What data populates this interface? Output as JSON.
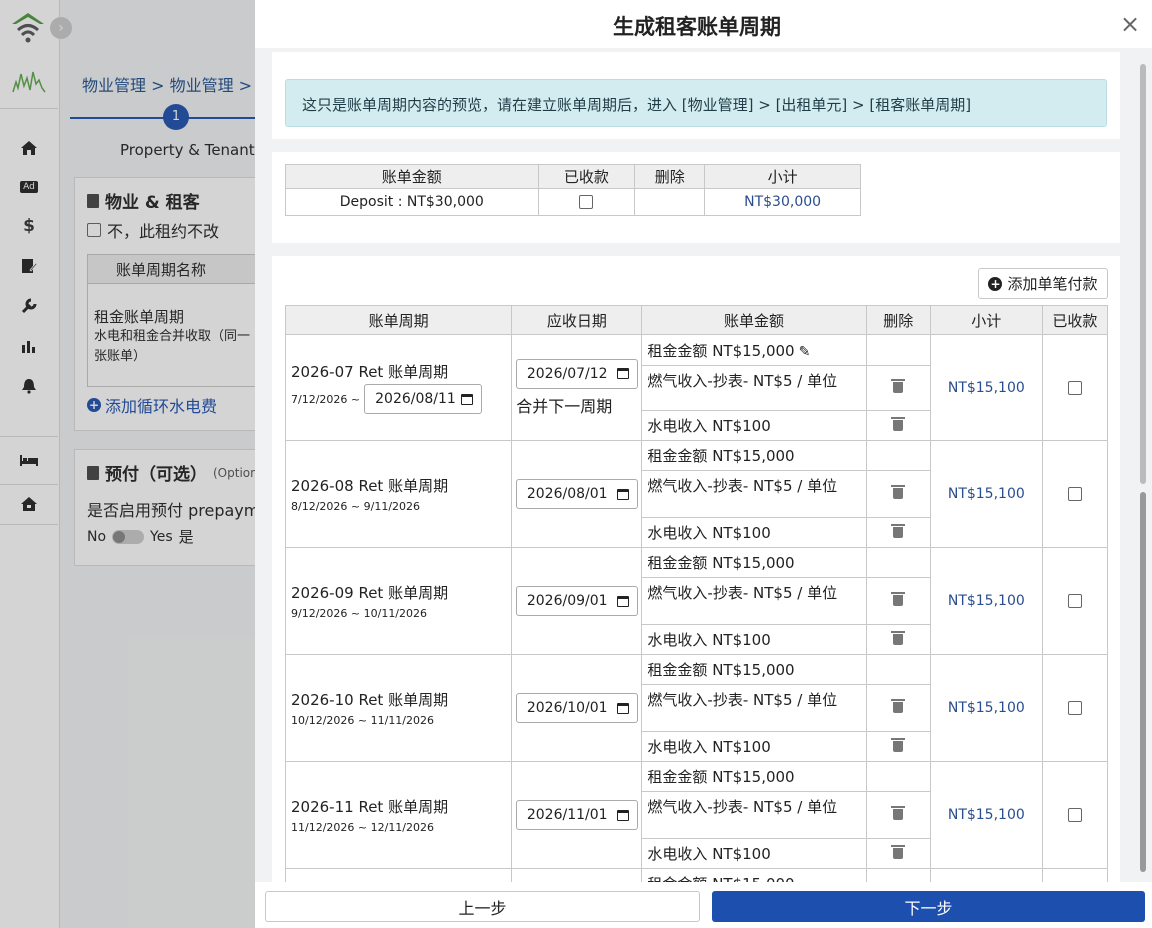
{
  "bg": {
    "breadcrumb": "物业管理 > 物业管理 > Ad",
    "step_number": "1",
    "step_label": "Property & Tenant",
    "section1_title": "物业 & 租客",
    "no_change_label": "不，此租约不改",
    "cycle_name_header": "账单周期名称",
    "cycle_name": "租金账单周期",
    "cycle_desc": "水电和租金合并收取（同一张账单）",
    "add_utility": "添加循环水电费",
    "section2_title": "预付（可选）",
    "section2_optional": "(Optional",
    "prepay_question": "是否启用预付 prepayme",
    "toggle_no": "No",
    "toggle_yes": "Yes",
    "toggle_yes_cn": "是"
  },
  "sidebar": {
    "icons": [
      "home-icon",
      "ad-icon",
      "dollar-icon",
      "edit-document-icon",
      "wrench-icon",
      "bar-chart-icon",
      "bell-icon",
      "bed-icon",
      "house-icon"
    ]
  },
  "modal": {
    "title": "生成租客账单周期",
    "close": "×",
    "notice": "这只是账单周期内容的预览，请在建立账单周期后，进入 [物业管理] > [出租单元] > [租客账单周期]",
    "deposit": {
      "headers": [
        "账单金额",
        "已收款",
        "删除",
        "小计"
      ],
      "row": {
        "amount": "Deposit : NT$30,000",
        "subtotal": "NT$30,000"
      }
    },
    "add_single_payment": "添加单笔付款",
    "periods_headers": [
      "账单周期",
      "应收日期",
      "账单金额",
      "删除",
      "小计",
      "已收款"
    ],
    "periods": [
      {
        "name": "2026-07 Ret 账单周期",
        "range": "7/12/2026 ~",
        "end_input": "2026/08/11",
        "due": "2026/07/12",
        "merge_note": "合并下一周期",
        "rent": "租金金额 NT$15,000",
        "gas": "燃气收入-抄表- NT$5 / 单位",
        "utility": "水电收入 NT$100",
        "subtotal": "NT$15,100"
      },
      {
        "name": "2026-08 Ret 账单周期",
        "range": "8/12/2026 ~ 9/11/2026",
        "due": "2026/08/01",
        "rent": "租金金额 NT$15,000",
        "gas": "燃气收入-抄表- NT$5 / 单位",
        "utility": "水电收入 NT$100",
        "subtotal": "NT$15,100"
      },
      {
        "name": "2026-09 Ret 账单周期",
        "range": "9/12/2026 ~ 10/11/2026",
        "due": "2026/09/01",
        "rent": "租金金额 NT$15,000",
        "gas": "燃气收入-抄表- NT$5 / 单位",
        "utility": "水电收入 NT$100",
        "subtotal": "NT$15,100"
      },
      {
        "name": "2026-10 Ret 账单周期",
        "range": "10/12/2026 ~ 11/11/2026",
        "due": "2026/10/01",
        "rent": "租金金额 NT$15,000",
        "gas": "燃气收入-抄表- NT$5 / 单位",
        "utility": "水电收入 NT$100",
        "subtotal": "NT$15,100"
      },
      {
        "name": "2026-11 Ret 账单周期",
        "range": "11/12/2026 ~ 12/11/2026",
        "due": "2026/11/01",
        "rent": "租金金额 NT$15,000",
        "gas": "燃气收入-抄表- NT$5 / 单位",
        "utility": "水电收入 NT$100",
        "subtotal": "NT$15,100"
      }
    ],
    "prev_button": "上一步",
    "next_button": "下一步"
  },
  "colors": {
    "accent": "#1d4fae",
    "notice_bg": "#d3ecef",
    "money": "#2a4d8f"
  }
}
